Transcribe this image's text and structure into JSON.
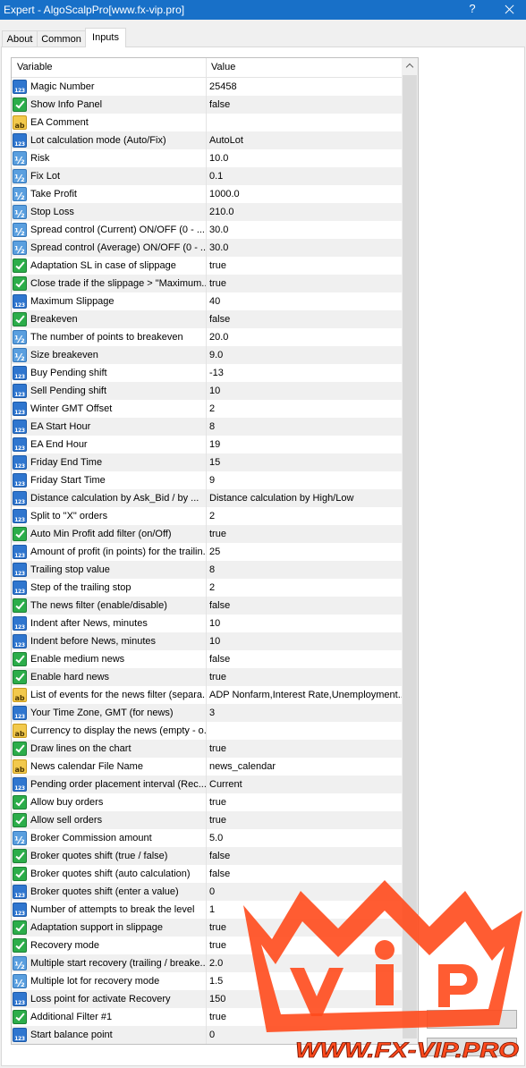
{
  "window": {
    "title": "Expert - AlgoScalpPro[www.fx-vip.pro]",
    "help_label": "?",
    "close_icon": "close-icon"
  },
  "tabs": [
    {
      "label": "About",
      "active": false
    },
    {
      "label": "Common",
      "active": false
    },
    {
      "label": "Inputs",
      "active": true
    }
  ],
  "table": {
    "headers": {
      "variable": "Variable",
      "value": "Value"
    },
    "rows": [
      {
        "icon": "integer-icon",
        "name": "Magic Number",
        "value": "25458"
      },
      {
        "icon": "boolean-icon",
        "name": "Show Info Panel",
        "value": "false"
      },
      {
        "icon": "string-icon",
        "name": "EA Comment",
        "value": ""
      },
      {
        "icon": "integer-icon",
        "name": "Lot calculation mode (Auto/Fix)",
        "value": "AutoLot"
      },
      {
        "icon": "double-icon",
        "name": "Risk",
        "value": "10.0"
      },
      {
        "icon": "double-icon",
        "name": "Fix Lot",
        "value": "0.1"
      },
      {
        "icon": "double-icon",
        "name": "Take Profit",
        "value": "1000.0"
      },
      {
        "icon": "double-icon",
        "name": "Stop Loss",
        "value": "210.0"
      },
      {
        "icon": "double-icon",
        "name": "Spread control (Current) ON/OFF (0 - ...",
        "value": "30.0"
      },
      {
        "icon": "double-icon",
        "name": "Spread control (Average) ON/OFF (0 - ...",
        "value": "30.0"
      },
      {
        "icon": "boolean-icon",
        "name": "Adaptation SL in case of slippage",
        "value": "true"
      },
      {
        "icon": "boolean-icon",
        "name": "Close trade if the slippage > \"Maximum...",
        "value": "true"
      },
      {
        "icon": "integer-icon",
        "name": "Maximum Slippage",
        "value": "40"
      },
      {
        "icon": "boolean-icon",
        "name": "Breakeven",
        "value": "false"
      },
      {
        "icon": "double-icon",
        "name": "The number of points to breakeven",
        "value": "20.0"
      },
      {
        "icon": "double-icon",
        "name": "Size breakeven",
        "value": "9.0"
      },
      {
        "icon": "integer-icon",
        "name": "Buy Pending shift",
        "value": "-13"
      },
      {
        "icon": "integer-icon",
        "name": "Sell Pending shift",
        "value": "10"
      },
      {
        "icon": "integer-icon",
        "name": "Winter GMT Offset",
        "value": "2"
      },
      {
        "icon": "integer-icon",
        "name": "EA Start Hour",
        "value": "8"
      },
      {
        "icon": "integer-icon",
        "name": "EA End Hour",
        "value": "19"
      },
      {
        "icon": "integer-icon",
        "name": "Friday End Time",
        "value": "15"
      },
      {
        "icon": "integer-icon",
        "name": "Friday Start Time",
        "value": "9"
      },
      {
        "icon": "integer-icon",
        "name": "Distance calculation by Ask_Bid / by ...",
        "value": "Distance calculation by High/Low"
      },
      {
        "icon": "integer-icon",
        "name": "Split to \"X\" orders",
        "value": "2"
      },
      {
        "icon": "boolean-icon",
        "name": "Auto Min Profit add filter (on/Off)",
        "value": "true"
      },
      {
        "icon": "integer-icon",
        "name": "Amount of profit (in points) for the trailin...",
        "value": "25"
      },
      {
        "icon": "integer-icon",
        "name": "Trailing stop value",
        "value": "8"
      },
      {
        "icon": "integer-icon",
        "name": "Step of the trailing stop",
        "value": "2"
      },
      {
        "icon": "boolean-icon",
        "name": "The news filter (enable/disable)",
        "value": "false"
      },
      {
        "icon": "integer-icon",
        "name": "Indent after News, minutes",
        "value": "10"
      },
      {
        "icon": "integer-icon",
        "name": "Indent before News, minutes",
        "value": "10"
      },
      {
        "icon": "boolean-icon",
        "name": "Enable medium news",
        "value": "false"
      },
      {
        "icon": "boolean-icon",
        "name": "Enable hard news",
        "value": "true"
      },
      {
        "icon": "string-icon",
        "name": "List of events for the news filter (separa...",
        "value": "ADP Nonfarm,Interest Rate,Unemployment..."
      },
      {
        "icon": "integer-icon",
        "name": "Your Time Zone, GMT (for news)",
        "value": "3"
      },
      {
        "icon": "string-icon",
        "name": "Currency to display the news (empty - o...",
        "value": ""
      },
      {
        "icon": "boolean-icon",
        "name": "Draw lines on the chart",
        "value": "true"
      },
      {
        "icon": "string-icon",
        "name": "News calendar File Name",
        "value": "news_calendar"
      },
      {
        "icon": "integer-icon",
        "name": "Pending order placement interval (Rec...",
        "value": "Current"
      },
      {
        "icon": "boolean-icon",
        "name": "Allow buy orders",
        "value": "true"
      },
      {
        "icon": "boolean-icon",
        "name": "Allow sell orders",
        "value": "true"
      },
      {
        "icon": "double-icon",
        "name": "Broker Commission amount",
        "value": "5.0"
      },
      {
        "icon": "boolean-icon",
        "name": "Broker quotes shift (true / false)",
        "value": "false"
      },
      {
        "icon": "boolean-icon",
        "name": "Broker quotes shift (auto calculation)",
        "value": "false"
      },
      {
        "icon": "integer-icon",
        "name": "Broker quotes shift (enter a value)",
        "value": "0"
      },
      {
        "icon": "integer-icon",
        "name": "Number of attempts to break the level",
        "value": "1"
      },
      {
        "icon": "boolean-icon",
        "name": "Adaptation support in slippage",
        "value": "true"
      },
      {
        "icon": "boolean-icon",
        "name": "Recovery mode",
        "value": "true"
      },
      {
        "icon": "double-icon",
        "name": "Multiple start recovery (trailing / breake...",
        "value": "2.0"
      },
      {
        "icon": "double-icon",
        "name": "Multiple lot for recovery mode",
        "value": "1.5"
      },
      {
        "icon": "integer-icon",
        "name": "Loss point for activate Recovery",
        "value": "150"
      },
      {
        "icon": "boolean-icon",
        "name": "Additional Filter #1",
        "value": "true"
      },
      {
        "icon": "integer-icon",
        "name": "Start balance point",
        "value": "0"
      }
    ]
  },
  "scrollbar": {
    "up_icon": "chevron-up-icon"
  },
  "watermark": {
    "text": "WWW.FX-VIP.PRO"
  },
  "colors": {
    "title_bar": "#1870c8",
    "watermark": "#ff4a1c"
  }
}
